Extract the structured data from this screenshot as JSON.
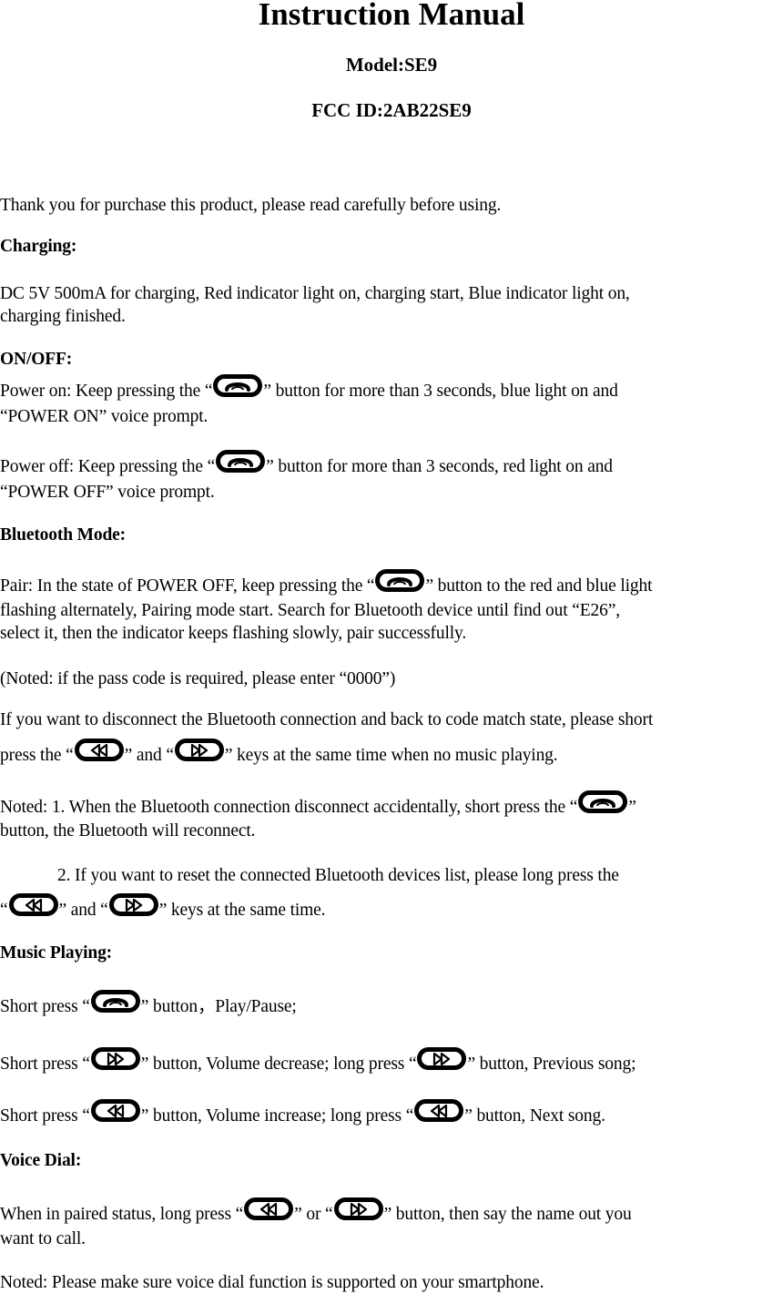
{
  "header": {
    "title": "Instruction Manual",
    "model": "Model:SE9",
    "fcc_id": "FCC ID:2AB22SE9"
  },
  "intro": "Thank you for purchase this product, please read carefully before using.",
  "icons": {
    "call": "phone-handset-icon",
    "rewind": "rewind-double-arrow-icon",
    "forward": "fast-forward-double-arrow-icon"
  },
  "charging": {
    "heading": "Charging:",
    "line1": "DC 5V 500mA for charging, Red indicator light on, charging start, Blue indicator light on,",
    "line2": "charging finished."
  },
  "onoff": {
    "heading": "ON/OFF:",
    "power_on_a": "Power on: Keep pressing the “",
    "power_on_b": "”  button for more than 3 seconds, blue light on and",
    "power_on_c": "“POWER ON” voice prompt.",
    "power_off_a": "Power off: Keep pressing the “",
    "power_off_b": "”  button for more than 3 seconds, red light on and",
    "power_off_c": "“POWER OFF” voice prompt."
  },
  "bluetooth": {
    "heading": "Bluetooth Mode:",
    "pair_a": "Pair: In the state of POWER OFF, keep pressing the “",
    "pair_b": "”  button to the red and blue light",
    "pair_c": "flashing alternately, Pairing mode start. Search for Bluetooth device until find out “E26”,",
    "pair_d": "select it, then the indicator keeps flashing slowly, pair successfully.",
    "passcode": "(Noted: if the pass code is required, please enter “0000”)",
    "disconnect_a": "If you want to disconnect the Bluetooth connection and back to code match state, please short",
    "disconnect_b": "press the “",
    "disconnect_c": "” and “",
    "disconnect_d": "” keys at the same time when no music playing.",
    "note1_a": "Noted: 1. When the Bluetooth connection disconnect accidentally, short press the “",
    "note1_b": "”",
    "note1_c": "button, the Bluetooth will reconnect.",
    "note2_a": "2. If you want to reset the connected Bluetooth devices list, please long press the",
    "note2_b": "“",
    "note2_c": "” and “",
    "note2_d": "” keys at the same time."
  },
  "music": {
    "heading": "Music Playing:",
    "play_a": "Short press “",
    "play_b": "” button，Play/Pause;",
    "vol_down_a": "Short press “",
    "vol_down_b": "” button, Volume decrease; long press “",
    "vol_down_c": "” button, Previous song;",
    "vol_up_a": "Short press “",
    "vol_up_b": "” button, Volume increase; long press “",
    "vol_up_c": "” button, Next song."
  },
  "voice_dial": {
    "heading": "Voice Dial:",
    "line1_a": "When in paired status, long press “",
    "line1_b": "” or “",
    "line1_c": "” button, then say the name out you",
    "line2": "want to call.",
    "note": "Noted: Please make sure voice dial function is supported on your smartphone."
  }
}
